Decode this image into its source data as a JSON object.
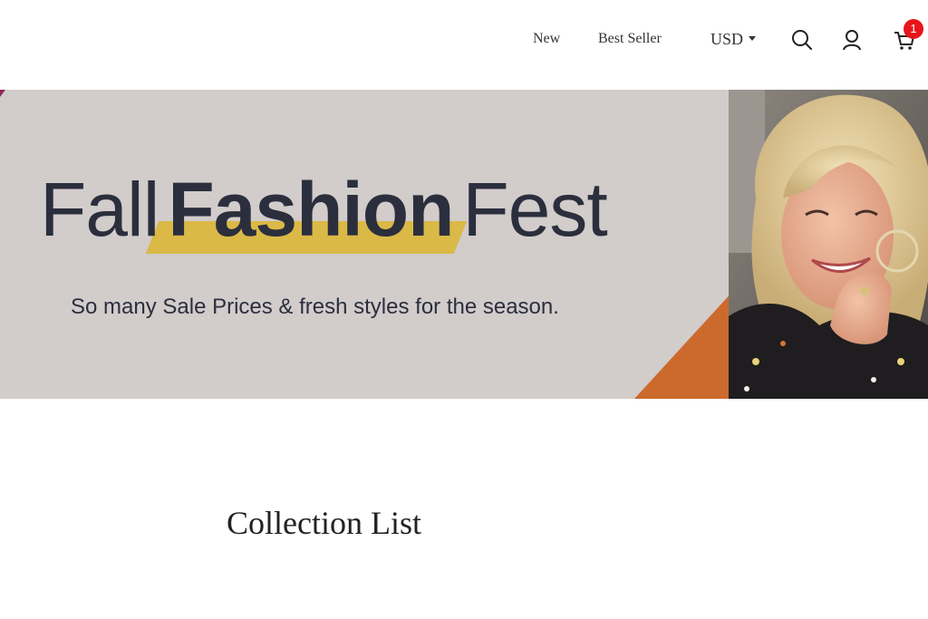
{
  "header": {
    "nav": [
      {
        "label": "New"
      },
      {
        "label": "Best Seller"
      }
    ],
    "currency": {
      "label": "USD"
    },
    "cart_count": "1",
    "icons": {
      "search": "search-icon",
      "account": "account-icon",
      "cart": "cart-icon"
    }
  },
  "banner": {
    "title_word_1": "Fall",
    "title_word_2": "Fashion",
    "title_word_3": "Fest",
    "subtitle": "So many Sale Prices & fresh styles for the season.",
    "colors": {
      "background": "#d2cccb",
      "title_text": "#2b2f3d",
      "highlight": "#dbb947",
      "orange_accent": "#cc6a2d"
    }
  },
  "collection": {
    "title": "Collection List"
  }
}
